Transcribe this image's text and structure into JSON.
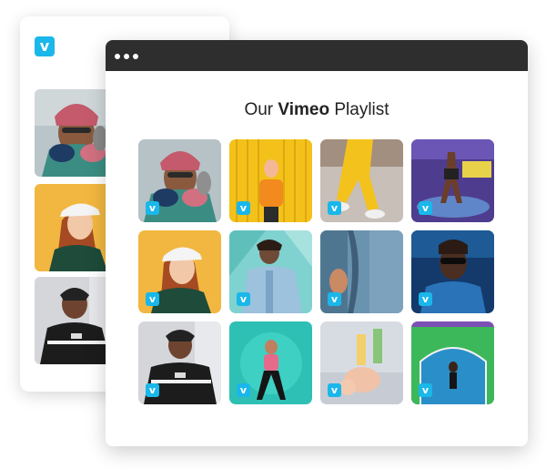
{
  "brand": {
    "logo_glyph": "v",
    "accent": "#1ab7ea"
  },
  "playlist": {
    "title_prefix": "Our",
    "title_brand": "Vimeo",
    "title_suffix": "Playlist"
  },
  "back_card": {
    "items": [
      {
        "subject": "man-beanie-neck-pillow"
      },
      {
        "subject": "woman-white-cap"
      },
      {
        "subject": "man-black-jacket"
      }
    ]
  },
  "videos": [
    {
      "subject": "man-beanie-neck-pillow"
    },
    {
      "subject": "person-yellow-backpack"
    },
    {
      "subject": "yellow-pants-sneakers"
    },
    {
      "subject": "handstand-purple-wall"
    },
    {
      "subject": "woman-white-cap"
    },
    {
      "subject": "man-denim-jacket"
    },
    {
      "subject": "hand-in-pocket"
    },
    {
      "subject": "woman-sunglasses-blue"
    },
    {
      "subject": "man-black-jacket"
    },
    {
      "subject": "woman-teal-background"
    },
    {
      "subject": "baby-on-blanket"
    },
    {
      "subject": "person-basketball-court"
    }
  ]
}
